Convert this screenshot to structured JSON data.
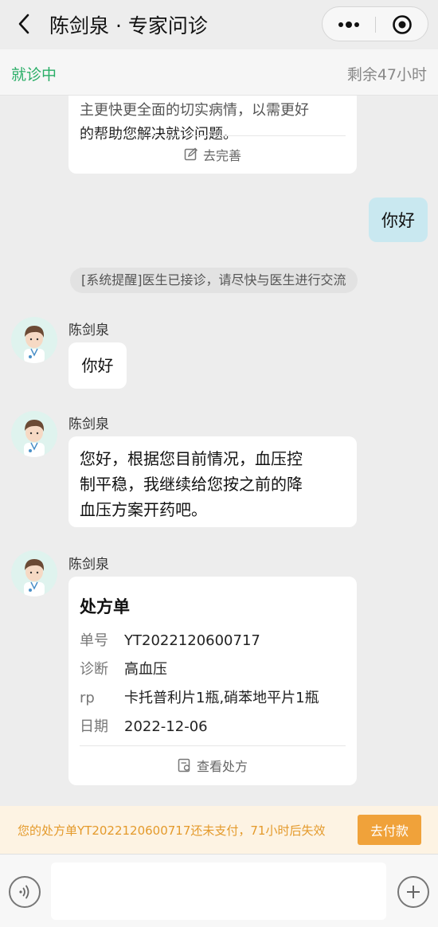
{
  "header": {
    "title": "陈剑泉 · 专家问诊"
  },
  "status": {
    "left": "就诊中",
    "right": "剩余47小时"
  },
  "info_card": {
    "text_line1": "主更快更全面的切实病情，以需更好",
    "text_line2": "的帮助您解决就诊问题。",
    "action": "去完善"
  },
  "messages": {
    "my_message": "你好",
    "system_tip": "[系统提醒]医生已接诊，请尽快与医生进行交流",
    "doctor_name": "陈剑泉",
    "doctor_msg_1": "你好",
    "doctor_msg_2_line1": "您好，根据您目前情况，血压控",
    "doctor_msg_2_line2": "制平稳，我继续给您按之前的降",
    "doctor_msg_2_line3": "血压方案开药吧。"
  },
  "prescription": {
    "title": "处方单",
    "rows": [
      {
        "label": "单号",
        "value": "YT2022120600717"
      },
      {
        "label": "诊断",
        "value": "高血压"
      },
      {
        "label": "rp",
        "value": "卡托普利片1瓶,硝苯地平片1瓶"
      },
      {
        "label": "日期",
        "value": "2022-12-06"
      }
    ],
    "action": "查看处方"
  },
  "pay_banner": {
    "text": "您的处方单YT2022120600717还未支付，71小时后失效",
    "button": "去付款"
  },
  "colors": {
    "accent_green": "#2aae67",
    "pay_orange": "#f0a23a",
    "my_bubble": "#c9e8f0"
  },
  "icons": [
    "back-arrow-icon",
    "more-dots-icon",
    "close-circle-icon",
    "edit-icon",
    "doctor-avatar",
    "document-icon",
    "voice-icon",
    "plus-icon"
  ]
}
